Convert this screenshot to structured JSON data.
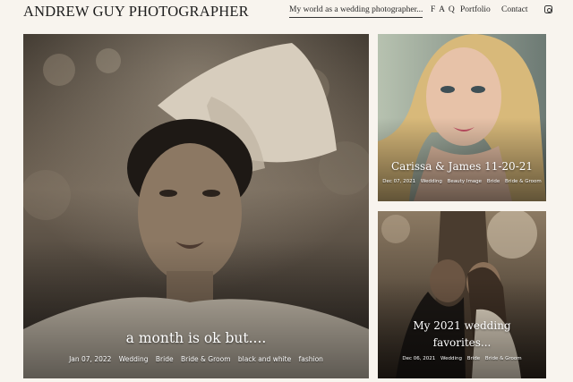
{
  "site": {
    "title": "ANDREW GUY PHOTOGRAPHER"
  },
  "nav": {
    "items": [
      {
        "label": "My world as a wedding photographer..."
      },
      {
        "label": "F A Q"
      },
      {
        "label": "Portfolio"
      },
      {
        "label": "Contact"
      }
    ],
    "icon": "instagram-icon"
  },
  "posts": [
    {
      "title": "a month is ok but....",
      "date": "Jan 07, 2022",
      "tags": [
        "Wedding",
        "Bride",
        "Bride & Groom",
        "black and white",
        "fashion"
      ]
    },
    {
      "title": "Carissa & James 11-20-21",
      "date": "Dec 07, 2021",
      "tags": [
        "Wedding",
        "Beauty Image",
        "Bride",
        "Bride & Groom"
      ]
    },
    {
      "title": "My 2021 wedding favorites...",
      "date": "Dec 06, 2021",
      "tags": [
        "Wedding",
        "Bride",
        "Bride & Groom"
      ]
    }
  ]
}
